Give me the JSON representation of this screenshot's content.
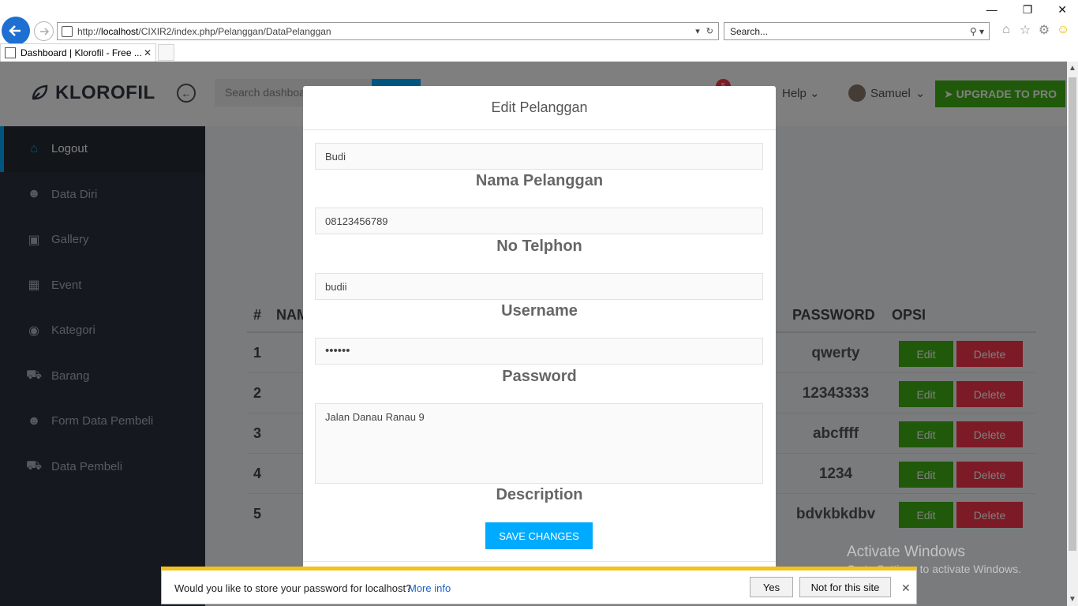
{
  "browser": {
    "url_prefix": "http://",
    "url_host": "localhost",
    "url_path": "/CIXIR2/index.php/Pelanggan/DataPelanggan",
    "search_placeholder": "Search...",
    "tab_title": "Dashboard | Klorofil - Free ...",
    "tab_close": "✕"
  },
  "header": {
    "brand": "KLOROFIL",
    "search_placeholder": "Search dashboard...",
    "notification_count": "5",
    "help_label": "Help",
    "user_name": "Samuel",
    "upgrade_label": "UPGRADE TO PRO"
  },
  "sidebar": {
    "items": [
      {
        "label": "Logout",
        "icon": "home-icon"
      },
      {
        "label": "Data Diri",
        "icon": "user-icon"
      },
      {
        "label": "Gallery",
        "icon": "picture-icon"
      },
      {
        "label": "Event",
        "icon": "calendar-icon"
      },
      {
        "label": "Kategori",
        "icon": "bag-icon"
      },
      {
        "label": "Barang",
        "icon": "cart-icon"
      },
      {
        "label": "Form Data Pembeli",
        "icon": "user-icon"
      },
      {
        "label": "Data Pembeli",
        "icon": "cart-icon"
      }
    ]
  },
  "table": {
    "headers": {
      "num": "#",
      "name": "NAM",
      "password": "PASSWORD",
      "opsi": "OPSI"
    },
    "rows": [
      {
        "num": "1",
        "password": "qwerty",
        "edit": "Edit",
        "delete": "Delete"
      },
      {
        "num": "2",
        "password": "12343333",
        "edit": "Edit",
        "delete": "Delete"
      },
      {
        "num": "3",
        "password": "abcffff",
        "edit": "Edit",
        "delete": "Delete"
      },
      {
        "num": "4",
        "password": "1234",
        "edit": "Edit",
        "delete": "Delete"
      },
      {
        "num": "5",
        "password": "bdvkbkdbv",
        "edit": "Edit",
        "delete": "Delete"
      }
    ]
  },
  "modal": {
    "title": "Edit Pelanggan",
    "nama_value": "Budi",
    "nama_label": "Nama Pelanggan",
    "telp_value": "08123456789",
    "telp_label": "No Telphon",
    "username_value": "budii",
    "username_label": "Username",
    "password_value": "••••••",
    "password_label": "Password",
    "description_value": "Jalan Danau Ranau 9",
    "description_label": "Description",
    "save_label": "SAVE CHANGES"
  },
  "watermark": {
    "line1": "Activate Windows",
    "line2": "Go to Settings to activate Windows."
  },
  "notification_bar": {
    "message": "Would you like to store your password for localhost?",
    "more_info": "More info",
    "yes": "Yes",
    "no": "Not for this site",
    "close": "✕"
  },
  "colors": {
    "accent": "#00aaff",
    "success": "#41b314",
    "danger": "#f9354c",
    "sidebar": "#2b333e"
  }
}
